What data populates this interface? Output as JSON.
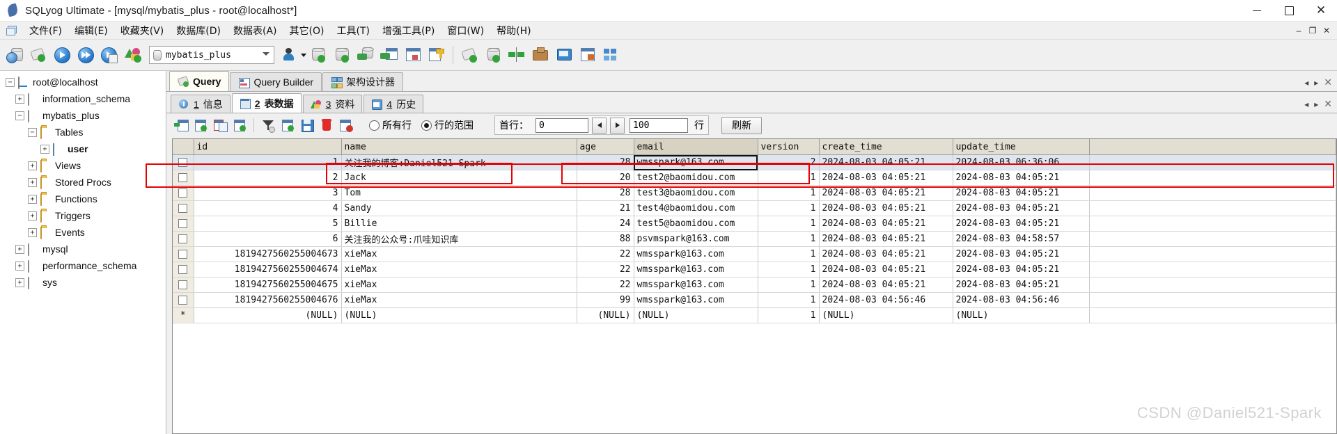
{
  "window": {
    "title": "SQLyog Ultimate - [mysql/mybatis_plus - root@localhost*]",
    "app_icon": "dolphin-icon",
    "minimize": "–",
    "maximize": "❐",
    "close": "✕"
  },
  "menubar": {
    "items": [
      {
        "label": "文件(F)",
        "name": "menu-file"
      },
      {
        "label": "编辑(E)",
        "name": "menu-edit"
      },
      {
        "label": "收藏夹(V)",
        "name": "menu-favorites"
      },
      {
        "label": "数据库(D)",
        "name": "menu-database"
      },
      {
        "label": "数据表(A)",
        "name": "menu-table"
      },
      {
        "label": "其它(O)",
        "name": "menu-other"
      },
      {
        "label": "工具(T)",
        "name": "menu-tools"
      },
      {
        "label": "增强工具(P)",
        "name": "menu-powertools"
      },
      {
        "label": "窗口(W)",
        "name": "menu-window"
      },
      {
        "label": "帮助(H)",
        "name": "menu-help"
      }
    ],
    "mdi_minimize": "–",
    "mdi_restore": "❐",
    "mdi_close": "✕"
  },
  "toolbar": {
    "database_selector_value": "mybatis_plus",
    "icons": [
      "new-connection-icon",
      "new-query-tab-icon",
      "execute-query-icon",
      "execute-all-queries-icon",
      "execute-query-current-icon",
      "stop-query-icon"
    ],
    "icons_right": [
      "user-manager-icon",
      "backup-database-icon",
      "restore-database-icon",
      "import-external-data-icon",
      "export-table-data-icon",
      "table-diagnostics-icon",
      "manage-indexes-icon",
      "new-query-window-icon",
      "database-sync-icon",
      "schema-sync-icon",
      "data-sync-icon",
      "notifications-icon",
      "scheduled-backup-icon",
      "query-formatter-icon"
    ]
  },
  "sidebar": {
    "items": [
      {
        "label": "root@localhost",
        "icon": "server-icon",
        "indent": 0,
        "expander": "-",
        "name": "tree-root-localhost"
      },
      {
        "label": "information_schema",
        "icon": "database-icon",
        "indent": 1,
        "expander": "+",
        "name": "tree-db-information-schema"
      },
      {
        "label": "mybatis_plus",
        "icon": "database-icon",
        "indent": 1,
        "expander": "-",
        "name": "tree-db-mybatis-plus"
      },
      {
        "label": "Tables",
        "icon": "folder-icon",
        "indent": 2,
        "expander": "-",
        "name": "tree-folder-tables"
      },
      {
        "label": "user",
        "icon": "table-icon",
        "indent": 3,
        "expander": "+",
        "name": "tree-table-user"
      },
      {
        "label": "Views",
        "icon": "folder-icon",
        "indent": 2,
        "expander": "+",
        "name": "tree-folder-views"
      },
      {
        "label": "Stored Procs",
        "icon": "folder-icon",
        "indent": 2,
        "expander": "+",
        "name": "tree-folder-stored-procs"
      },
      {
        "label": "Functions",
        "icon": "folder-icon",
        "indent": 2,
        "expander": "+",
        "name": "tree-folder-functions"
      },
      {
        "label": "Triggers",
        "icon": "folder-icon",
        "indent": 2,
        "expander": "+",
        "name": "tree-folder-triggers"
      },
      {
        "label": "Events",
        "icon": "folder-icon",
        "indent": 2,
        "expander": "+",
        "name": "tree-folder-events"
      },
      {
        "label": "mysql",
        "icon": "database-icon",
        "indent": 1,
        "expander": "+",
        "name": "tree-db-mysql"
      },
      {
        "label": "performance_schema",
        "icon": "database-icon",
        "indent": 1,
        "expander": "+",
        "name": "tree-db-performance-schema"
      },
      {
        "label": "sys",
        "icon": "database-icon",
        "indent": 1,
        "expander": "+",
        "name": "tree-db-sys"
      }
    ]
  },
  "editor_tabs": {
    "tabs": [
      {
        "label": "Query",
        "icon": "query-icon",
        "active": true,
        "name": "tab-query"
      },
      {
        "label": "Query Builder",
        "icon": "query-builder-icon",
        "active": false,
        "name": "tab-query-builder"
      },
      {
        "label": "架构设计器",
        "icon": "schema-designer-icon",
        "active": false,
        "name": "tab-schema-designer"
      }
    ],
    "nav_prev": "◂",
    "nav_next": "▸",
    "close": "✕"
  },
  "result_tabs": {
    "tabs": [
      {
        "num": "1",
        "label": "信息",
        "icon": "info-icon",
        "active": false,
        "name": "result-tab-info"
      },
      {
        "num": "2",
        "label": "表数据",
        "icon": "table-data-icon",
        "active": true,
        "name": "result-tab-table-data"
      },
      {
        "num": "3",
        "label": "资料",
        "icon": "profile-icon",
        "active": false,
        "name": "result-tab-profile"
      },
      {
        "num": "4",
        "label": "历史",
        "icon": "history-icon",
        "active": false,
        "name": "result-tab-history"
      }
    ],
    "nav_prev": "◂",
    "nav_next": "▸",
    "close": "✕"
  },
  "grid_toolbar": {
    "icons": [
      "insert-row-icon",
      "duplicate-row-icon",
      "copy-row-to-clipboard-icon",
      "add-row-icon",
      "filter-icon",
      "refresh-row-icon",
      "save-changes-icon",
      "delete-row-icon",
      "cancel-changes-icon"
    ],
    "radio_all_rows": "所有行",
    "radio_row_range": "行的范围",
    "selected_radio": "row_range",
    "first_row_label": "首行：",
    "first_row_value": "0",
    "prev_arrow": "◀",
    "next_arrow": "▶",
    "limit_value": "100",
    "rows_label": "行",
    "refresh_button": "刷新"
  },
  "grid": {
    "columns": [
      "id",
      "name",
      "age",
      "email",
      "version",
      "create_time",
      "update_time"
    ],
    "selected_column": "email",
    "rows": [
      {
        "id": "1",
        "name": "关注我的博客:Daniel521-Spark",
        "age": "28",
        "email": "wmsspark@163.com",
        "version": "2",
        "create_time": "2024-08-03 04:05:21",
        "update_time": "2024-08-03 06:36:06",
        "selected": true
      },
      {
        "id": "2",
        "name": "Jack",
        "age": "20",
        "email": "test2@baomidou.com",
        "version": "1",
        "create_time": "2024-08-03 04:05:21",
        "update_time": "2024-08-03 04:05:21",
        "selected": false
      },
      {
        "id": "3",
        "name": "Tom",
        "age": "28",
        "email": "test3@baomidou.com",
        "version": "1",
        "create_time": "2024-08-03 04:05:21",
        "update_time": "2024-08-03 04:05:21",
        "selected": false
      },
      {
        "id": "4",
        "name": "Sandy",
        "age": "21",
        "email": "test4@baomidou.com",
        "version": "1",
        "create_time": "2024-08-03 04:05:21",
        "update_time": "2024-08-03 04:05:21",
        "selected": false
      },
      {
        "id": "5",
        "name": "Billie",
        "age": "24",
        "email": "test5@baomidou.com",
        "version": "1",
        "create_time": "2024-08-03 04:05:21",
        "update_time": "2024-08-03 04:05:21",
        "selected": false
      },
      {
        "id": "6",
        "name": "关注我的公众号:爪哇知识库",
        "age": "88",
        "email": "psvmspark@163.com",
        "version": "1",
        "create_time": "2024-08-03 04:05:21",
        "update_time": "2024-08-03 04:58:57",
        "selected": false
      },
      {
        "id": "1819427560255004673",
        "name": "xieMax",
        "age": "22",
        "email": "wmsspark@163.com",
        "version": "1",
        "create_time": "2024-08-03 04:05:21",
        "update_time": "2024-08-03 04:05:21",
        "selected": false
      },
      {
        "id": "1819427560255004674",
        "name": "xieMax",
        "age": "22",
        "email": "wmsspark@163.com",
        "version": "1",
        "create_time": "2024-08-03 04:05:21",
        "update_time": "2024-08-03 04:05:21",
        "selected": false
      },
      {
        "id": "1819427560255004675",
        "name": "xieMax",
        "age": "22",
        "email": "wmsspark@163.com",
        "version": "1",
        "create_time": "2024-08-03 04:05:21",
        "update_time": "2024-08-03 04:05:21",
        "selected": false
      },
      {
        "id": "1819427560255004676",
        "name": "xieMax",
        "age": "99",
        "email": "wmsspark@163.com",
        "version": "1",
        "create_time": "2024-08-03 04:56:46",
        "update_time": "2024-08-03 04:56:46",
        "selected": false
      }
    ],
    "new_row": {
      "marker": "*",
      "id": "(NULL)",
      "name": "(NULL)",
      "age": "(NULL)",
      "email": "(NULL)",
      "version": "1",
      "create_time": "(NULL)",
      "update_time": "(NULL)"
    }
  },
  "watermark": "CSDN @Daniel521-Spark",
  "colors": {
    "accent": "#2c7fd0",
    "annotation": "#e60000",
    "header_bg": "#e3ded2",
    "selected_row": "#dfe6f0"
  }
}
